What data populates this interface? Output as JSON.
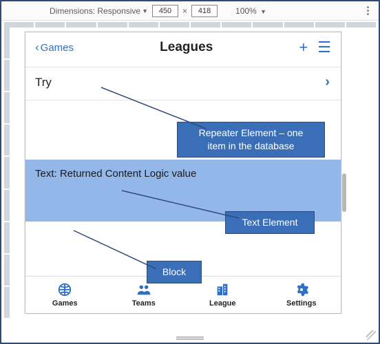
{
  "devtools": {
    "dimensions_label": "Dimensions:",
    "mode": "Responsive",
    "width": "450",
    "height": "418",
    "zoom": "100%"
  },
  "app": {
    "back_label": "Games",
    "title": "Leagues",
    "list": {
      "items": [
        {
          "label": "Try"
        }
      ]
    },
    "block": {
      "text_prefix": "Text",
      "text_value": ": Returned Content Logic value"
    },
    "tabs": [
      {
        "id": "games",
        "label": "Games"
      },
      {
        "id": "teams",
        "label": "Teams"
      },
      {
        "id": "league",
        "label": "League"
      },
      {
        "id": "settings",
        "label": "Settings"
      }
    ]
  },
  "callouts": {
    "repeater": "Repeater Element – one\nitem in the database",
    "text_el": "Text Element",
    "block": "Block"
  }
}
